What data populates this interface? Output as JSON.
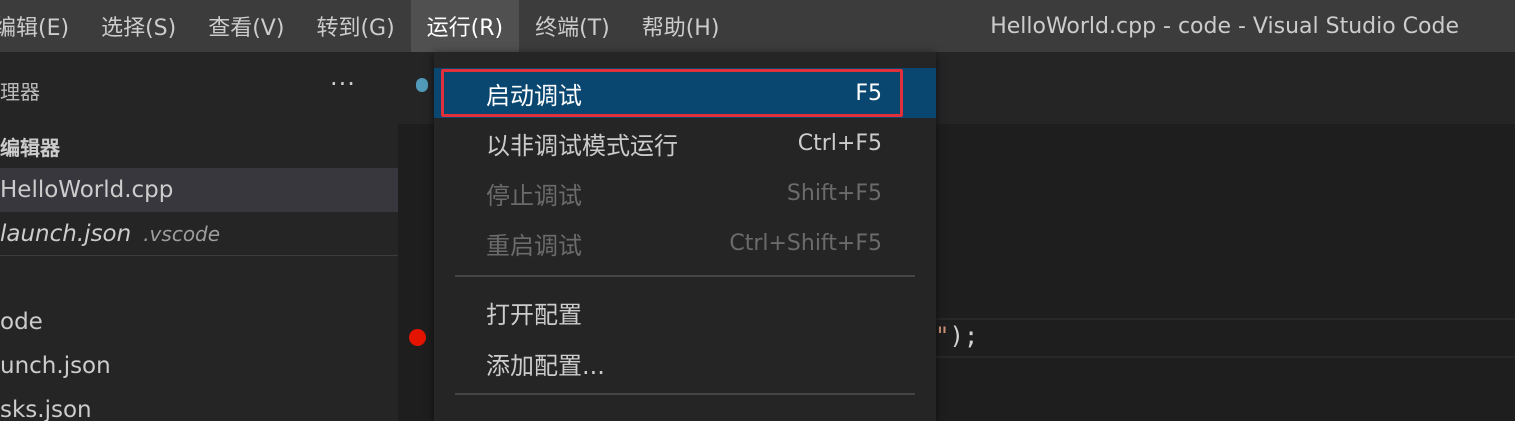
{
  "menubar": {
    "items": [
      "编辑(E)",
      "选择(S)",
      "查看(V)",
      "转到(G)",
      "运行(R)",
      "终端(T)",
      "帮助(H)"
    ],
    "active_index": 4
  },
  "window_title": "HelloWorld.cpp - code - Visual Studio Code",
  "sidebar": {
    "header": "理器",
    "more_icon": "···",
    "open_editors_title": "编辑器",
    "open_editors": [
      {
        "name": "HelloWorld.cpp",
        "desc": ""
      },
      {
        "name": "launch.json",
        "desc": ".vscode"
      }
    ],
    "folder_items": [
      "ode",
      "unch.json",
      "sks.json"
    ]
  },
  "editor": {
    "code_tail_string": "\"",
    "code_tail_rest": ");"
  },
  "run_menu": {
    "items": [
      {
        "label": "启动调试",
        "key": "F5",
        "state": "highlighted"
      },
      {
        "label": "以非调试模式运行",
        "key": "Ctrl+F5",
        "state": "enabled"
      },
      {
        "label": "停止调试",
        "key": "Shift+F5",
        "state": "disabled"
      },
      {
        "label": "重启调试",
        "key": "Ctrl+Shift+F5",
        "state": "disabled"
      },
      {
        "label": "打开配置",
        "key": "",
        "state": "enabled"
      },
      {
        "label": "添加配置...",
        "key": "",
        "state": "enabled"
      }
    ]
  },
  "colors": {
    "highlight": "#094771",
    "annotation_frame": "#e0303c",
    "breakpoint": "#e51400"
  }
}
